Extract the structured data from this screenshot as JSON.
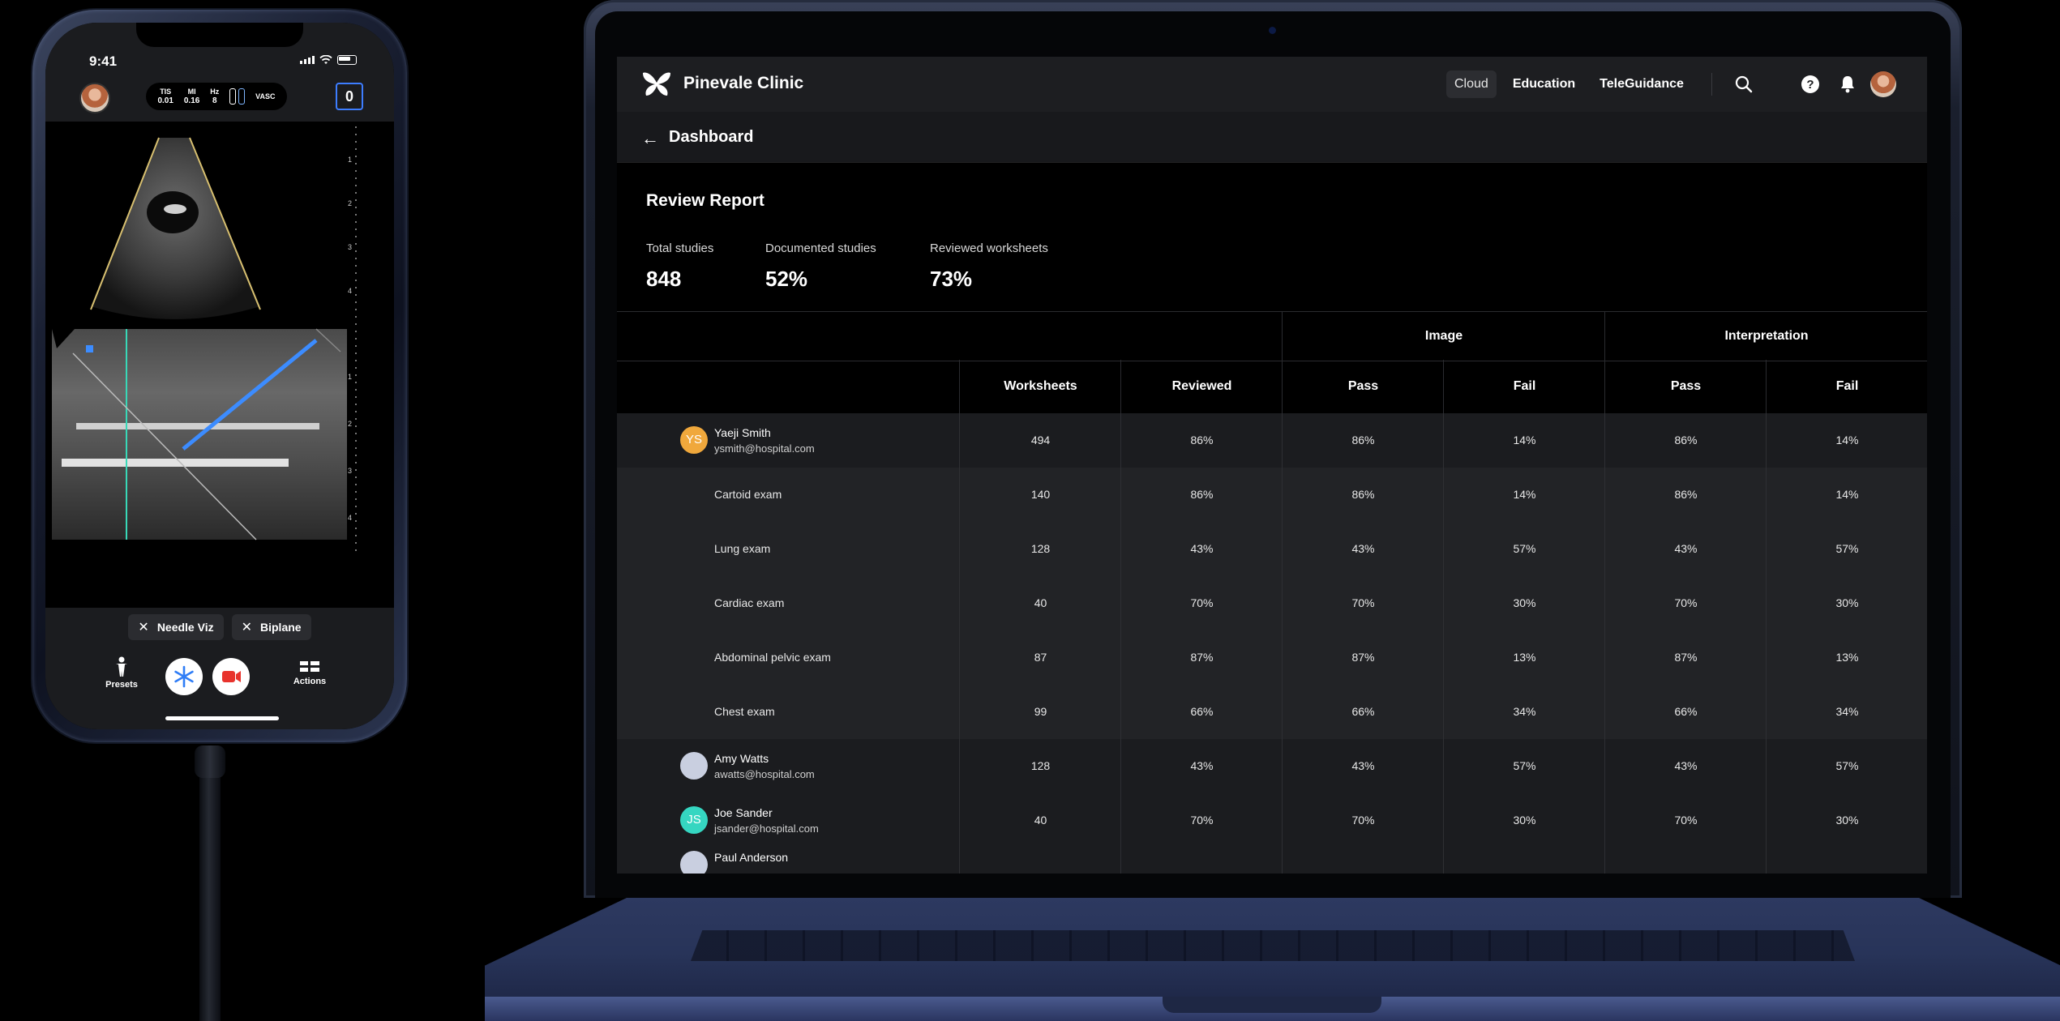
{
  "phone": {
    "status_time": "9:41",
    "params": [
      {
        "key": "TIS",
        "value": "0.01"
      },
      {
        "key": "MI",
        "value": "0.16"
      },
      {
        "key": "Hz",
        "value": "8"
      }
    ],
    "mode": "VASC",
    "counter": "0",
    "depth_scale_top": [
      "1",
      "2",
      "3",
      "4"
    ],
    "depth_scale_bottom": [
      "1",
      "2",
      "3",
      "4"
    ],
    "chips": [
      "Needle Viz",
      "Biplane"
    ],
    "actions": {
      "presets": "Presets",
      "actions": "Actions"
    }
  },
  "app": {
    "brand": "Pinevale Clinic",
    "nav": {
      "cloud": "Cloud",
      "education": "Education",
      "teleguidance": "TeleGuidance"
    },
    "page": "Dashboard",
    "report_title": "Review Report",
    "stats": [
      {
        "label": "Total studies",
        "value": "848"
      },
      {
        "label": "Documented studies",
        "value": "52%"
      },
      {
        "label": "Reviewed worksheets",
        "value": "73%"
      }
    ],
    "groups": {
      "image": "Image",
      "interpretation": "Interpretation"
    },
    "columns": [
      "Worksheets",
      "Reviewed",
      "Pass",
      "Fail",
      "Pass",
      "Fail"
    ],
    "rows": [
      {
        "type": "person",
        "initials": "YS",
        "avatar_color": "#f0a83c",
        "name": "Yaeji Smith",
        "email": "ysmith@hospital.com",
        "values": [
          "494",
          "86%",
          "86%",
          "14%",
          "86%",
          "14%"
        ]
      },
      {
        "type": "exam",
        "name": "Cartoid exam",
        "values": [
          "140",
          "86%",
          "86%",
          "14%",
          "86%",
          "14%"
        ]
      },
      {
        "type": "exam",
        "name": "Lung exam",
        "values": [
          "128",
          "43%",
          "43%",
          "57%",
          "43%",
          "57%"
        ]
      },
      {
        "type": "exam",
        "name": "Cardiac exam",
        "values": [
          "40",
          "70%",
          "70%",
          "30%",
          "70%",
          "30%"
        ]
      },
      {
        "type": "exam",
        "name": "Abdominal pelvic exam",
        "values": [
          "87",
          "87%",
          "87%",
          "13%",
          "87%",
          "13%"
        ]
      },
      {
        "type": "exam",
        "name": "Chest exam",
        "values": [
          "99",
          "66%",
          "66%",
          "34%",
          "66%",
          "34%"
        ]
      },
      {
        "type": "person",
        "initials": "",
        "avatar_color": "#c9cfe0",
        "name": "Amy Watts",
        "email": "awatts@hospital.com",
        "values": [
          "128",
          "43%",
          "43%",
          "57%",
          "43%",
          "57%"
        ]
      },
      {
        "type": "person",
        "initials": "JS",
        "avatar_color": "#35d6c1",
        "name": "Joe Sander",
        "email": "jsander@hospital.com",
        "values": [
          "40",
          "70%",
          "70%",
          "30%",
          "70%",
          "30%"
        ]
      },
      {
        "type": "person",
        "initials": "",
        "avatar_color": "#c9cfe0",
        "name": "Paul Anderson",
        "email": "",
        "values": [
          "",
          "",
          "",
          "",
          "",
          ""
        ]
      }
    ]
  }
}
